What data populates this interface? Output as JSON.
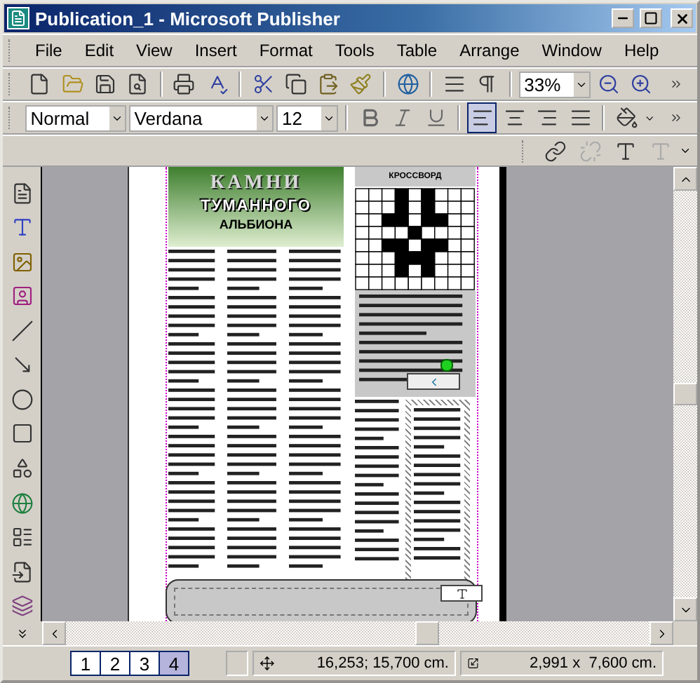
{
  "window": {
    "title": "Publication_1 - Microsoft Publisher"
  },
  "menu": [
    "File",
    "Edit",
    "View",
    "Insert",
    "Format",
    "Tools",
    "Table",
    "Arrange",
    "Window",
    "Help"
  ],
  "standard_toolbar": {
    "zoom": "33%"
  },
  "formatting_toolbar": {
    "style": "Normal",
    "font": "Verdana",
    "size": "12",
    "align_buttons": [
      {
        "selected": true
      },
      {
        "selected": false
      },
      {
        "selected": false
      },
      {
        "selected": false
      }
    ]
  },
  "document": {
    "heading_top": "КАМНИ",
    "heading_middle": "ТУМАННОГО",
    "heading_bottom": "АЛЬБИОНА",
    "crossword_title": "КРОССВОРД"
  },
  "status_bar": {
    "pages": [
      {
        "label": "1",
        "selected": false
      },
      {
        "label": "2",
        "selected": false
      },
      {
        "label": "3",
        "selected": false
      },
      {
        "label": "4",
        "selected": true
      }
    ],
    "position": "16,253; 15,700 cm.",
    "size": "2,991 x  7,600 cm."
  }
}
